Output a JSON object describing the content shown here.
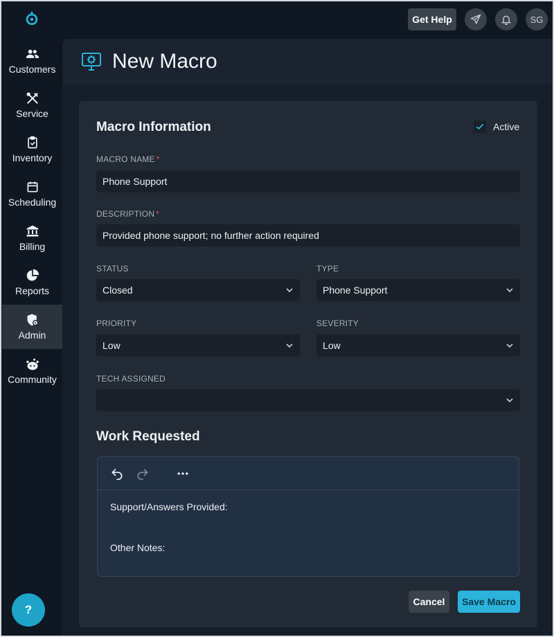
{
  "nav": {
    "items": [
      {
        "label": "Customers",
        "icon": "users-icon"
      },
      {
        "label": "Service",
        "icon": "tools-icon"
      },
      {
        "label": "Inventory",
        "icon": "clipboard-check-icon"
      },
      {
        "label": "Scheduling",
        "icon": "calendar-icon"
      },
      {
        "label": "Billing",
        "icon": "bank-icon"
      },
      {
        "label": "Reports",
        "icon": "pie-chart-icon"
      },
      {
        "label": "Admin",
        "icon": "shield-gear-icon",
        "active": true
      },
      {
        "label": "Community",
        "icon": "community-icon"
      }
    ],
    "help_label": "?"
  },
  "topbar": {
    "get_help": "Get Help",
    "avatar_initials": "SG"
  },
  "page": {
    "title": "New Macro"
  },
  "form": {
    "section_title": "Macro Information",
    "active_label": "Active",
    "active_checked": true,
    "macro_name_label": "MACRO NAME",
    "macro_name_value": "Phone Support",
    "description_label": "DESCRIPTION",
    "description_value": "Provided phone support; no further action required",
    "status_label": "STATUS",
    "status_value": "Closed",
    "type_label": "TYPE",
    "type_value": "Phone Support",
    "priority_label": "PRIORITY",
    "priority_value": "Low",
    "severity_label": "SEVERITY",
    "severity_value": "Low",
    "tech_label": "TECH ASSIGNED",
    "tech_value": "",
    "required_mark": "*"
  },
  "work": {
    "title": "Work Requested",
    "lines": [
      "Support/Answers Provided:",
      "Other Notes:"
    ]
  },
  "actions": {
    "cancel": "Cancel",
    "save": "Save Macro"
  },
  "colors": {
    "accent": "#2bb3dc",
    "background": "#0f1722",
    "card": "#222a35"
  }
}
